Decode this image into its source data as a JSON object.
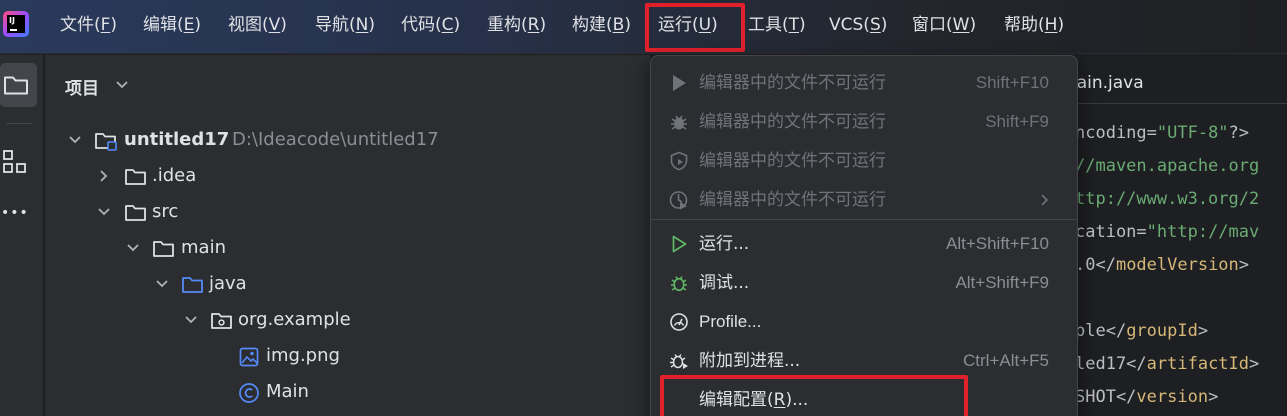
{
  "menubar": {
    "logo_text": "IJ",
    "items": [
      {
        "label": "文件",
        "key": "F"
      },
      {
        "label": "编辑",
        "key": "E"
      },
      {
        "label": "视图",
        "key": "V"
      },
      {
        "label": "导航",
        "key": "N"
      },
      {
        "label": "代码",
        "key": "C"
      },
      {
        "label": "重构",
        "key": "R"
      },
      {
        "label": "构建",
        "key": "B"
      },
      {
        "label": "运行",
        "key": "U"
      },
      {
        "label": "工具",
        "key": "T"
      },
      {
        "label": "VCS",
        "key": "S"
      },
      {
        "label": "窗口",
        "key": "W"
      },
      {
        "label": "帮助",
        "key": "H"
      }
    ]
  },
  "toolstrip": {
    "icons": [
      "folder-icon",
      "structure-icon",
      "more-icon"
    ],
    "more_label": "•••"
  },
  "project_panel": {
    "title": "项目",
    "tree": [
      {
        "label": "untitled17",
        "path": "D:\\Ideacode\\untitled17",
        "icon": "module-folder-icon",
        "expanded": true
      },
      {
        "label": ".idea",
        "icon": "folder-icon",
        "expanded": false
      },
      {
        "label": "src",
        "icon": "folder-icon",
        "expanded": true
      },
      {
        "label": "main",
        "icon": "folder-icon",
        "expanded": true
      },
      {
        "label": "java",
        "icon": "source-folder-icon",
        "expanded": true
      },
      {
        "label": "org.example",
        "icon": "package-icon",
        "expanded": true
      },
      {
        "label": "img.png",
        "icon": "image-file-icon"
      },
      {
        "label": "Main",
        "icon": "java-class-icon"
      }
    ]
  },
  "editor": {
    "tab_label": "lain.java",
    "lines": [
      [
        {
          "t": "ncoding=",
          "c": "attr"
        },
        {
          "t": "\"UTF-8\"",
          "c": "str"
        },
        {
          "t": "?>",
          "c": "attr"
        }
      ],
      [
        {
          "t": "//maven.apache.org",
          "c": "str"
        }
      ],
      [
        {
          "t": "ttp://www.w3.org/2",
          "c": "str"
        }
      ],
      [
        {
          "t": "cation=",
          "c": "attr"
        },
        {
          "t": "\"http://mav",
          "c": "str"
        }
      ],
      [
        {
          "t": ".0</",
          "c": "attr"
        },
        {
          "t": "modelVersion",
          "c": "tag"
        },
        {
          "t": ">",
          "c": "attr"
        }
      ],
      [],
      [
        {
          "t": "ple</",
          "c": "attr"
        },
        {
          "t": "groupId",
          "c": "tag"
        },
        {
          "t": ">",
          "c": "attr"
        }
      ],
      [
        {
          "t": "led17</",
          "c": "attr"
        },
        {
          "t": "artifactId",
          "c": "tag"
        },
        {
          "t": ">",
          "c": "attr"
        }
      ],
      [
        {
          "t": "SHOT</",
          "c": "attr"
        },
        {
          "t": "version",
          "c": "tag"
        },
        {
          "t": ">",
          "c": "attr"
        }
      ]
    ]
  },
  "run_menu": {
    "items": [
      {
        "label": "编辑器中的文件不可运行",
        "shortcut": "Shift+F10",
        "icon": "run-icon",
        "enabled": false
      },
      {
        "label": "编辑器中的文件不可运行",
        "shortcut": "Shift+F9",
        "icon": "debug-icon",
        "enabled": false
      },
      {
        "label": "编辑器中的文件不可运行",
        "shortcut": "",
        "icon": "coverage-icon",
        "enabled": false
      },
      {
        "label": "编辑器中的文件不可运行",
        "shortcut": "",
        "icon": "profiler-icon",
        "enabled": false,
        "submenu": true
      },
      {
        "label": "运行...",
        "shortcut": "Alt+Shift+F10",
        "icon": "run-icon",
        "enabled": true
      },
      {
        "label": "调试...",
        "shortcut": "Alt+Shift+F9",
        "icon": "debug-icon",
        "enabled": true
      },
      {
        "label": "Profile...",
        "shortcut": "",
        "icon": "profile-gauge-icon",
        "enabled": true
      },
      {
        "label": "附加到进程...",
        "shortcut": "Ctrl+Alt+F5",
        "icon": "attach-debugger-icon",
        "enabled": true
      },
      {
        "label": "编辑配置(R)...",
        "label_pre": "编辑配置(",
        "label_key": "R",
        "label_post": ")...",
        "shortcut": "",
        "icon": "",
        "enabled": true
      }
    ]
  },
  "colors": {
    "highlight": "#e0212b",
    "run_green": "#5fb865",
    "disabled": "#6f737a"
  }
}
